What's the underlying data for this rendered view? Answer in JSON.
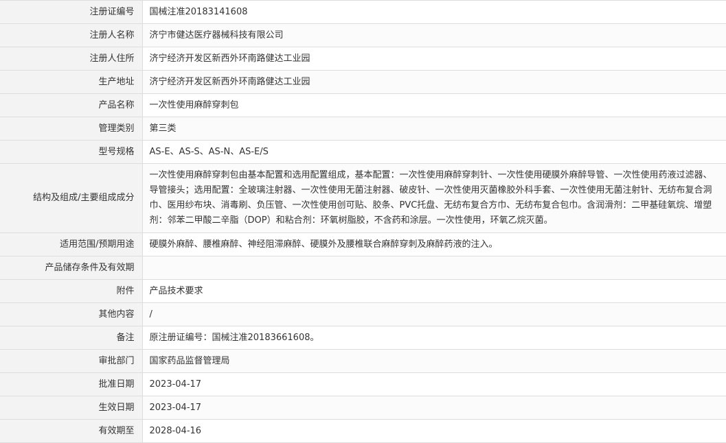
{
  "record": {
    "rows": [
      {
        "label": "注册证编号",
        "value": "国械注准20183141608"
      },
      {
        "label": "注册人名称",
        "value": "济宁市健达医疗器械科技有限公司"
      },
      {
        "label": "注册人住所",
        "value": "济宁经济开发区新西外环南路健达工业园"
      },
      {
        "label": "生产地址",
        "value": "济宁经济开发区新西外环南路健达工业园"
      },
      {
        "label": "产品名称",
        "value": "一次性使用麻醉穿刺包"
      },
      {
        "label": "管理类别",
        "value": "第三类"
      },
      {
        "label": "型号规格",
        "value": "AS-E、AS-S、AS-N、AS-E/S"
      },
      {
        "label": "结构及组成/主要组成成分",
        "value": "一次性使用麻醉穿刺包由基本配置和选用配置组成，基本配置：一次性使用麻醉穿刺针、一次性使用硬膜外麻醉导管、一次性使用药液过滤器、导管接头；选用配置：全玻璃注射器、一次性使用无菌注射器、破皮针、一次性使用灭菌橡胶外科手套、一次性使用无菌注射针、无纺布复合洞巾、医用纱布块、消毒刷、负压管、一次性使用创可贴、胶条、PVC托盘、无纺布复合方巾、无纺布复合包巾。含润滑剂：二甲基硅氧烷、增塑剂：邻苯二甲酸二辛脂（DOP）和粘合剂：环氧树脂胶，不含药和涂层。一次性使用，环氧乙烷灭菌。"
      },
      {
        "label": "适用范围/预期用途",
        "value": "硬膜外麻醉、腰椎麻醉、神经阻滞麻醉、硬膜外及腰椎联合麻醉穿刺及麻醉药液的注入。"
      },
      {
        "label": "产品储存条件及有效期",
        "value": ""
      },
      {
        "label": "附件",
        "value": "产品技术要求"
      },
      {
        "label": "其他内容",
        "value": "/"
      },
      {
        "label": "备注",
        "value": "原注册证编号：国械注准20183661608。"
      },
      {
        "label": "审批部门",
        "value": "国家药品监督管理局"
      },
      {
        "label": "批准日期",
        "value": "2023-04-17"
      },
      {
        "label": "生效日期",
        "value": "2023-04-17"
      },
      {
        "label": "有效期至",
        "value": "2028-04-16"
      }
    ]
  }
}
